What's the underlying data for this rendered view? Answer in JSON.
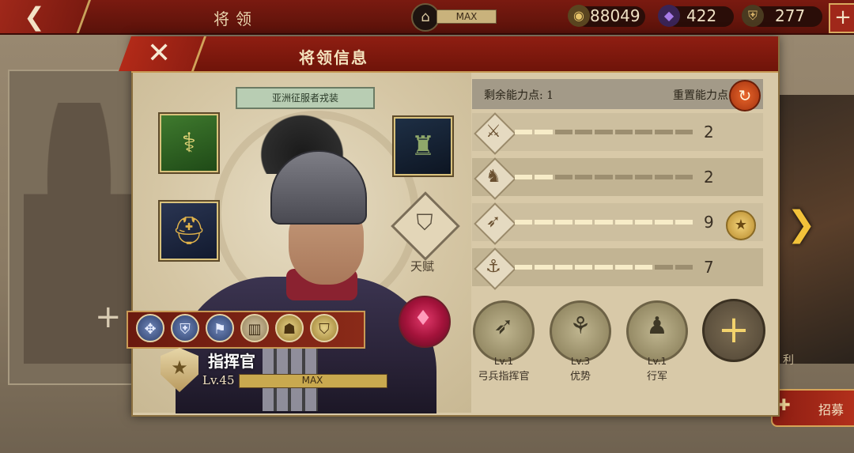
{
  "header": {
    "title": "将领",
    "bank_value": "MAX",
    "resources": [
      {
        "name": "gold-coin",
        "value": "88049",
        "color": "#d6b05a"
      },
      {
        "name": "purple-gem",
        "value": "422",
        "color": "#8e5bd6"
      },
      {
        "name": "helmet-token",
        "value": "277",
        "color": "#c9a25b"
      }
    ]
  },
  "dialog": {
    "title": "将领信息",
    "skin_label": "亚洲征服者戎装",
    "talent_label": "天赋",
    "rank_title": "指挥官",
    "level": "Lv.45",
    "level_bar_text": "MAX"
  },
  "points": {
    "remaining_label": "剩余能力点: 1",
    "reset_label": "重置能力点"
  },
  "stats": [
    {
      "icon": "sword-icon",
      "value": "2",
      "filled": 2,
      "segments": 9
    },
    {
      "icon": "horse-icon",
      "value": "2",
      "filled": 2,
      "segments": 9
    },
    {
      "icon": "bow-icon",
      "value": "9",
      "filled": 9,
      "segments": 9
    },
    {
      "icon": "anchor-icon",
      "value": "7",
      "filled": 7,
      "segments": 9
    }
  ],
  "skills": [
    {
      "icon": "bow-skill-icon",
      "level": "Lv.1",
      "name": "弓兵指挥官"
    },
    {
      "icon": "archers-skill-icon",
      "level": "Lv.3",
      "name": "优势"
    },
    {
      "icon": "march-skill-icon",
      "level": "Lv.1",
      "name": "行军"
    }
  ],
  "side": {
    "recruit_label": "招募",
    "right_partial_text": "利"
  }
}
